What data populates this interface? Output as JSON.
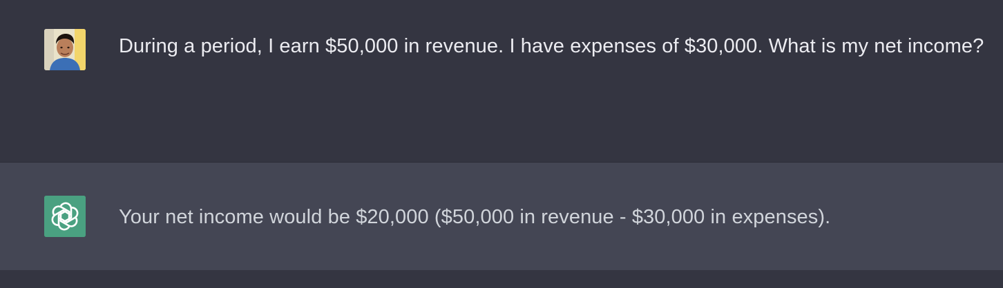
{
  "conversation": {
    "messages": [
      {
        "role": "user",
        "avatar": "user-photo-avatar",
        "text": "During a period, I earn $50,000 in revenue. I have expenses of $30,000. What is my net income?"
      },
      {
        "role": "assistant",
        "avatar": "openai-logo-icon",
        "text": "Your net income would be $20,000 ($50,000 in revenue - $30,000 in expenses)."
      }
    ]
  },
  "colors": {
    "user_bg": "#343541",
    "assistant_bg": "#444654",
    "assistant_avatar_bg": "#4aa181",
    "text": "#ececf1"
  }
}
